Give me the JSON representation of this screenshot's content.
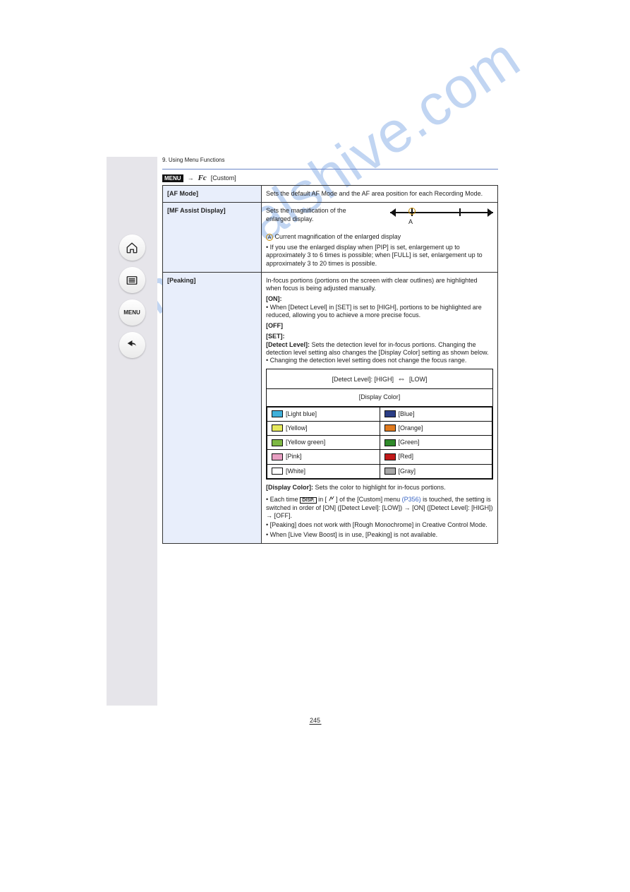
{
  "header": {
    "breadcrumb": "9. Using Menu Functions"
  },
  "menubar": {
    "menu_chip": "MENU",
    "arrow": "→",
    "fc": "Fc",
    "label": "[Custom]"
  },
  "rows": [
    {
      "left": "[AF Mode]",
      "right": "Sets the default AF Mode and the AF area position for each Recording Mode."
    },
    {
      "left": "[MF Assist Display]",
      "right": {
        "lead": "Sets the magnification of the enlarged display.",
        "A_label": "A",
        "A_desc": "Current magnification of the enlarged display",
        "bullet": "If you use the enlarged display when [PIP] is set, enlargement up to approximately 3 to 6 times is possible; when [FULL] is set, enlargement up to approximately 3 to 20 times is possible."
      }
    },
    {
      "left": "[Peaking]",
      "right": {
        "intro": "In-focus portions (portions on the screen with clear outlines) are highlighted when focus is being adjusted manually.",
        "on_lead": "[ON]:",
        "on_body": "When [Detect Level] in [SET] is set to [HIGH], portions to be highlighted are reduced, allowing you to achieve a more precise focus.",
        "off": "[OFF]",
        "set_lead": "[SET]:",
        "set_dl": "[Detect Level]:",
        "set_dl_body": "Sets the detection level for in-focus portions. Changing the detection level setting also changes the [Display Color] setting as shown below.",
        "table": {
          "head_left": "[Detect Level]: [HIGH]",
          "head_arrow": "⇔",
          "head_right": "[LOW]",
          "subhead": "[Display Color]",
          "pairs": [
            {
              "l_color": "#3fb0da",
              "l_label": "Light blue",
              "r_color": "#2b3e86",
              "r_label": "Blue"
            },
            {
              "l_color": "#e6e95d",
              "l_label": "Yellow",
              "r_color": "#e07a1e",
              "r_label": "Orange"
            },
            {
              "l_color": "#7db843",
              "l_label": "Yellow green",
              "r_color": "#2f8a2a",
              "r_label": "Green"
            },
            {
              "l_color": "#e79fc2",
              "l_label": "Pink",
              "r_color": "#c11a1a",
              "r_label": "Red"
            },
            {
              "l_color": "#ffffff",
              "l_label": "White",
              "r_color": "#a7a7a7",
              "r_label": "Gray"
            }
          ]
        },
        "dc": "[Display Color]: Sets the color to highlight for in-focus portions.",
        "foot1_pre": "Each time ",
        "foot1_chip": "DISP.",
        "foot1_mid": " in [ ",
        "foot1_mid2": " ] of the [Custom] menu ",
        "foot1_link": "(P356)",
        "foot1_after": " is touched, the setting is switched in order of [ON] ([Detect Level]: [LOW]) → [ON] ([Detect Level]: [HIGH]) → [OFF].",
        "foot2": "[Peaking] does not work with [Rough Monochrome] in Creative Control Mode.",
        "foot3": "When [Live View Boost] is in use, [Peaking] is not available."
      }
    }
  ],
  "page_number": "245",
  "watermark": "manualshive.com"
}
